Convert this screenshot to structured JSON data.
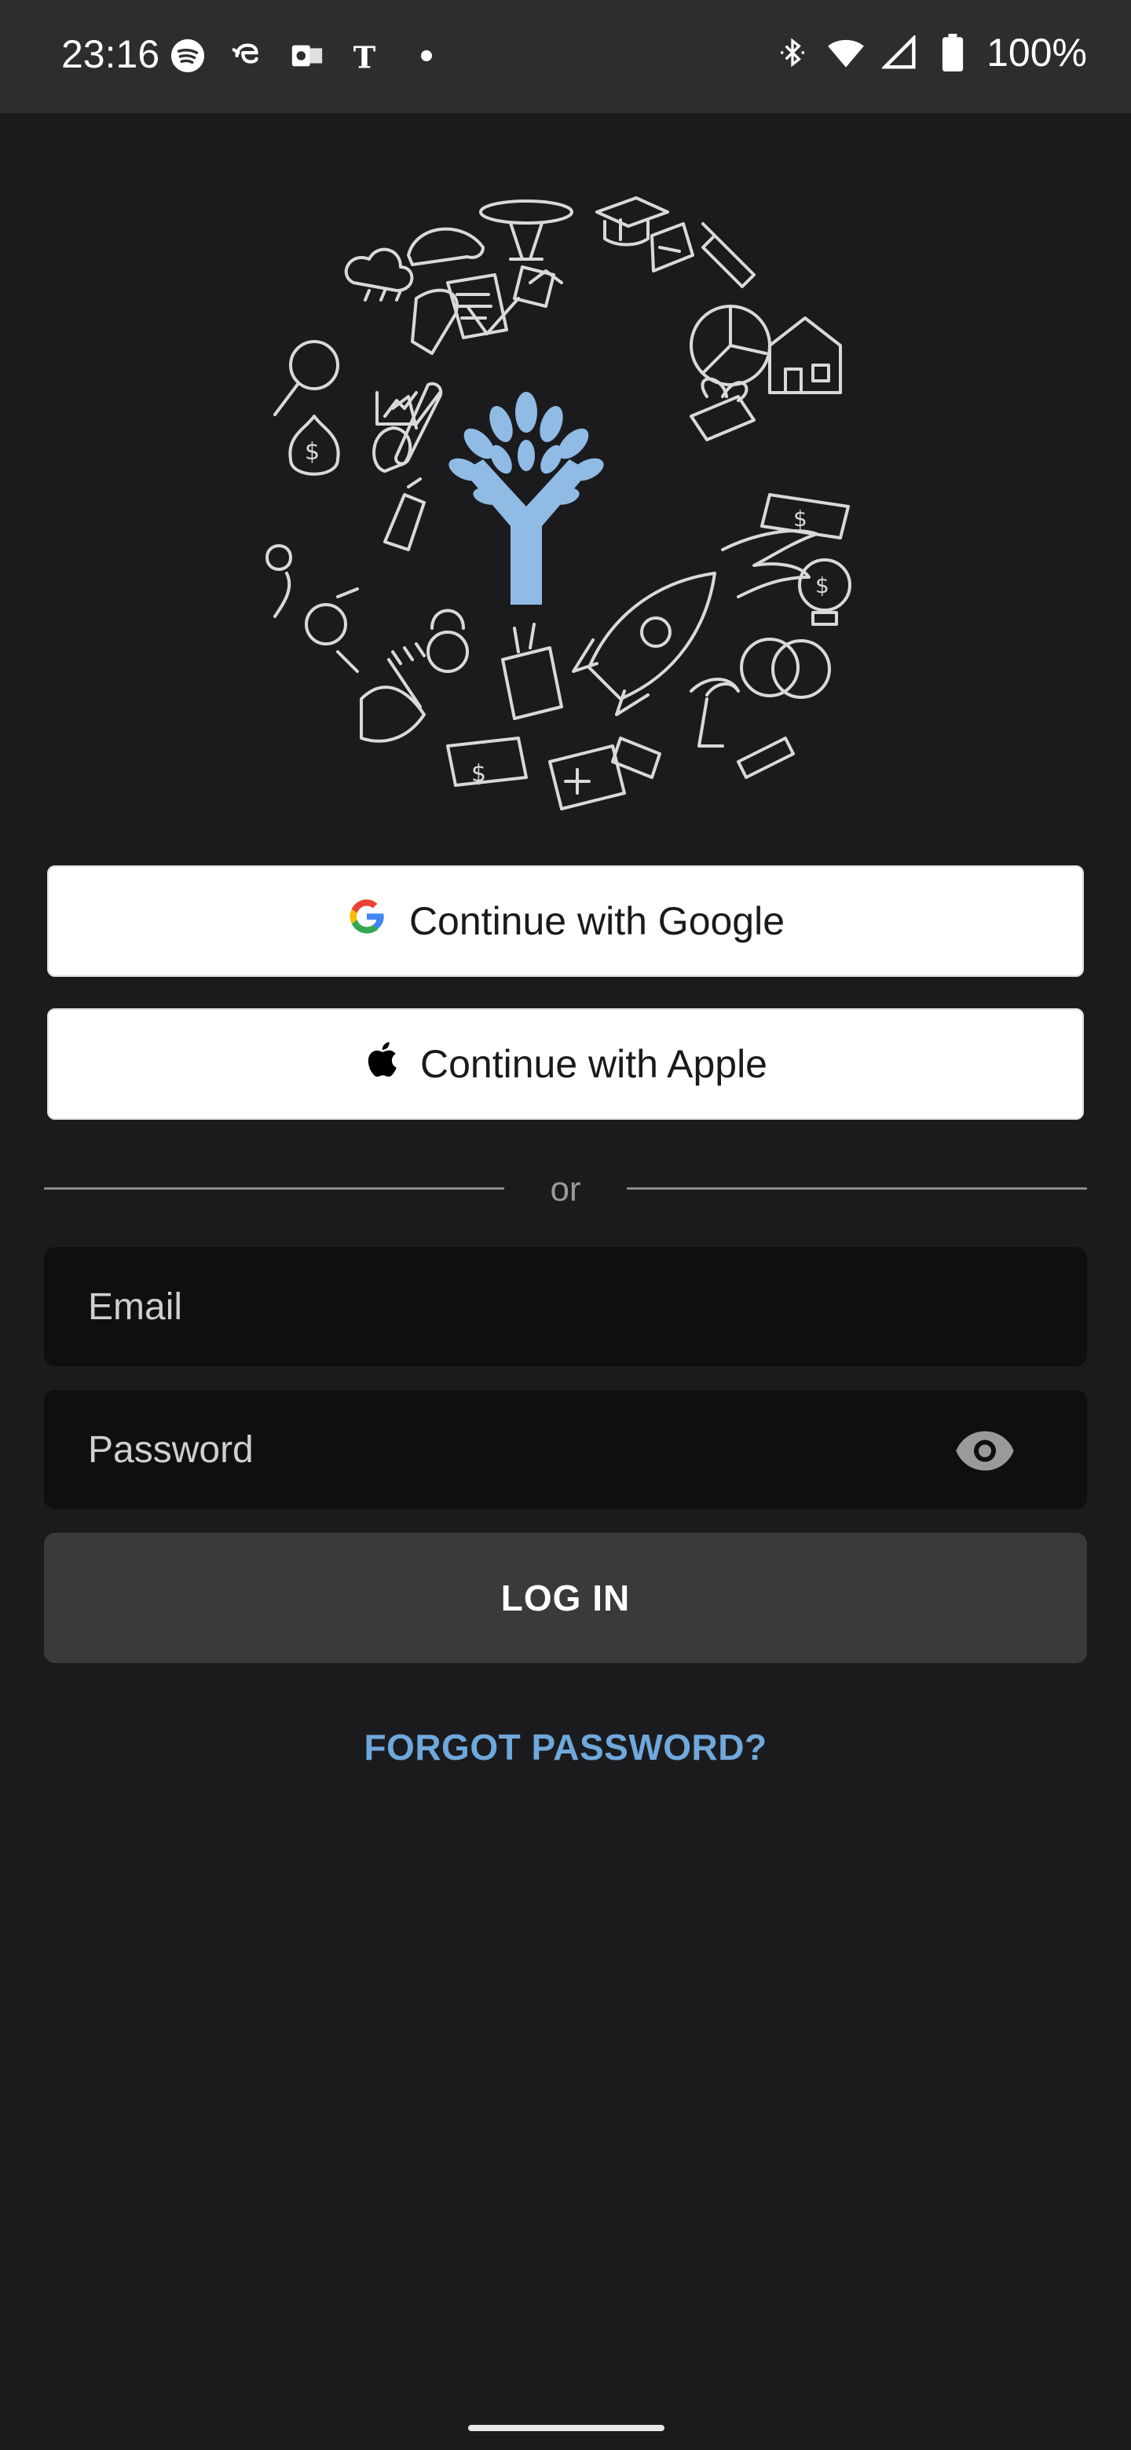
{
  "status_bar": {
    "time": "23:16",
    "battery": "100%",
    "left_icons": [
      "spotify-icon",
      "app-notification-icon",
      "outlook-icon",
      "nytimes-icon",
      "dot-icon"
    ],
    "right_icons": [
      "bluetooth-icon",
      "wifi-icon",
      "signal-icon",
      "battery-icon"
    ]
  },
  "auth": {
    "google_label": "Continue with Google",
    "apple_label": "Continue with Apple",
    "divider_text": "or",
    "email_placeholder": "Email",
    "password_placeholder": "Password",
    "login_label": "LOG IN",
    "forgot_label": "FORGOT PASSWORD?"
  },
  "colors": {
    "background": "#1b1b1e",
    "accent": "#6fa8dc",
    "logo": "#8fbbe5"
  }
}
